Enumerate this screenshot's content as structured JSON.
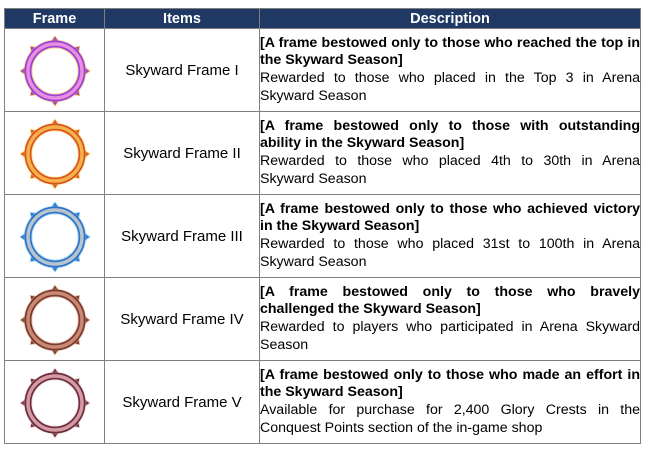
{
  "table": {
    "headers": {
      "frame": "Frame",
      "items": "Items",
      "description": "Description"
    },
    "rows": [
      {
        "icon": "skyward-frame-1-icon",
        "item": "Skyward Frame I",
        "title": "[A frame bestowed only to those who reached the top in the Skyward Season]",
        "text": "Rewarded to those who placed in the Top 3 in Arena Skyward Season",
        "colors": {
          "outer": "#9b3fd6",
          "inner": "#e68ee0",
          "accent": "#f3c14a"
        }
      },
      {
        "icon": "skyward-frame-2-icon",
        "item": "Skyward Frame II",
        "title": "[A frame bestowed only to those with outstanding ability in the Skyward Season]",
        "text": "Rewarded to those who placed 4th to 30th in Arena Skyward Season",
        "colors": {
          "outer": "#d9531e",
          "inner": "#f4b24a",
          "accent": "#ffe07a"
        }
      },
      {
        "icon": "skyward-frame-3-icon",
        "item": "Skyward Frame III",
        "title": "[A frame bestowed only to those who achieved victory in the Skyward Season]",
        "text": "Rewarded to those who placed 31st to 100th in Arena Skyward Season",
        "colors": {
          "outer": "#2f74c4",
          "inner": "#b9c4cf",
          "accent": "#8fd0ff"
        }
      },
      {
        "icon": "skyward-frame-4-icon",
        "item": "Skyward Frame IV",
        "title": "[A frame bestowed only to those who bravely challenged the Skyward Season]",
        "text": "Rewarded to players who participated in Arena Skyward Season",
        "colors": {
          "outer": "#7a3b2c",
          "inner": "#c98a74",
          "accent": "#e7b8a6"
        }
      },
      {
        "icon": "skyward-frame-5-icon",
        "item": "Skyward Frame V",
        "title": "[A frame bestowed only to those who made an effort in the Skyward Season]",
        "text": "Available for purchase for 2,400 Glory Crests in the Conquest Points section of the in-game shop",
        "colors": {
          "outer": "#6b2f3c",
          "inner": "#d59aa6",
          "accent": "#f1d1d8"
        }
      }
    ]
  }
}
